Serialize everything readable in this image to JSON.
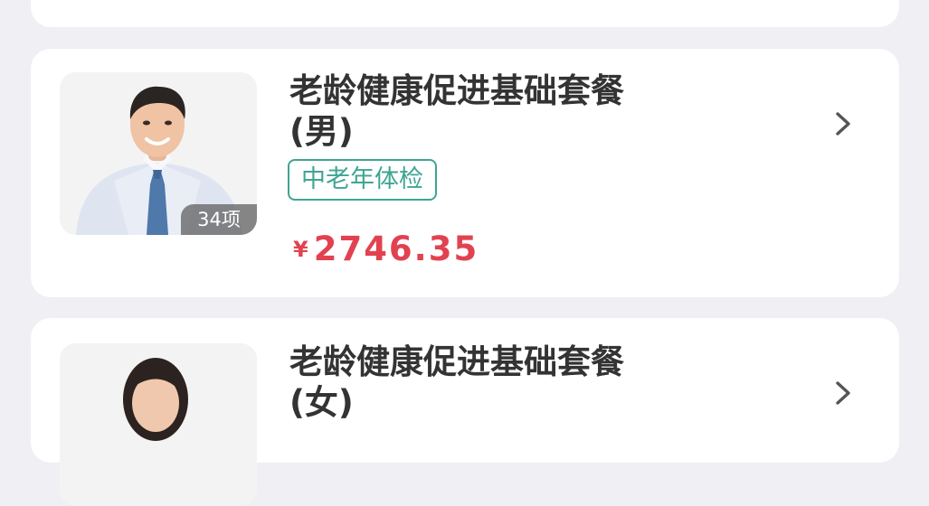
{
  "packages": [
    {
      "title_line1": "老龄健康促进基础套餐",
      "title_line2": "(男)",
      "tag": "中老年体检",
      "item_count": "34项",
      "currency": "¥",
      "price": "2746.35"
    },
    {
      "title_line1": "老龄健康促进基础套餐",
      "title_line2": "(女)"
    }
  ],
  "colors": {
    "accent_green": "#3ea592",
    "price_red": "#e24250",
    "background": "#efeff4"
  },
  "icons": {
    "chevron": "chevron-right-icon"
  }
}
